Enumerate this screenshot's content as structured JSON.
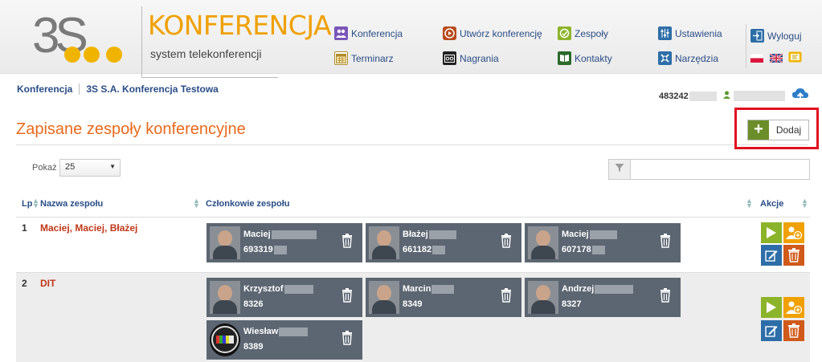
{
  "brand": {
    "logo_text": "3S",
    "title": "KONFERENCJA",
    "subtitle": "system telekonferencji"
  },
  "nav": {
    "konferencja": "Konferencja",
    "utworz": "Utwórz konferencję",
    "zespoly": "Zespoły",
    "ustawienia": "Ustawienia",
    "wyloguj": "Wyloguj",
    "terminarz": "Terminarz",
    "nagrania": "Nagrania",
    "kontakty": "Kontakty",
    "narzedzia": "Narzędzia"
  },
  "breadcrumb": {
    "root": "Konferencja",
    "current": "3S S.A. Konferencja Testowa"
  },
  "account": {
    "number": "483242"
  },
  "page": {
    "title": "Zapisane zespoły konferencyjne",
    "add_label": "Dodaj",
    "show_label": "Pokaż",
    "show_value": "25",
    "filter_value": ""
  },
  "table": {
    "headers": {
      "lp": "Lp",
      "name": "Nazwa zespołu",
      "members": "Członkowie zespołu",
      "actions": "Akcje"
    },
    "rows": [
      {
        "lp": "1",
        "name": "Maciej, Maciej, Błażej",
        "members": [
          {
            "name": "Maciej",
            "number": "693319"
          },
          {
            "name": "Błażej",
            "number": "661182"
          },
          {
            "name": "Maciej",
            "number": "607178"
          }
        ]
      },
      {
        "lp": "2",
        "name": "DIT",
        "members": [
          {
            "name": "Krzysztof",
            "number": "8326"
          },
          {
            "name": "Marcin",
            "number": "8349"
          },
          {
            "name": "Andrzej",
            "number": "8327"
          },
          {
            "name": "Wiesław",
            "number": "8389"
          }
        ]
      }
    ]
  },
  "colors": {
    "accent_orange": "#e86a1c",
    "brand_yellow": "#f0b400",
    "link_blue": "#2a4d86",
    "card_bg": "#5c6672",
    "start_green": "#8cb42a",
    "delete_red": "#d05a1a",
    "edit_blue": "#2d6ea8",
    "highlight_red": "#e01020"
  }
}
